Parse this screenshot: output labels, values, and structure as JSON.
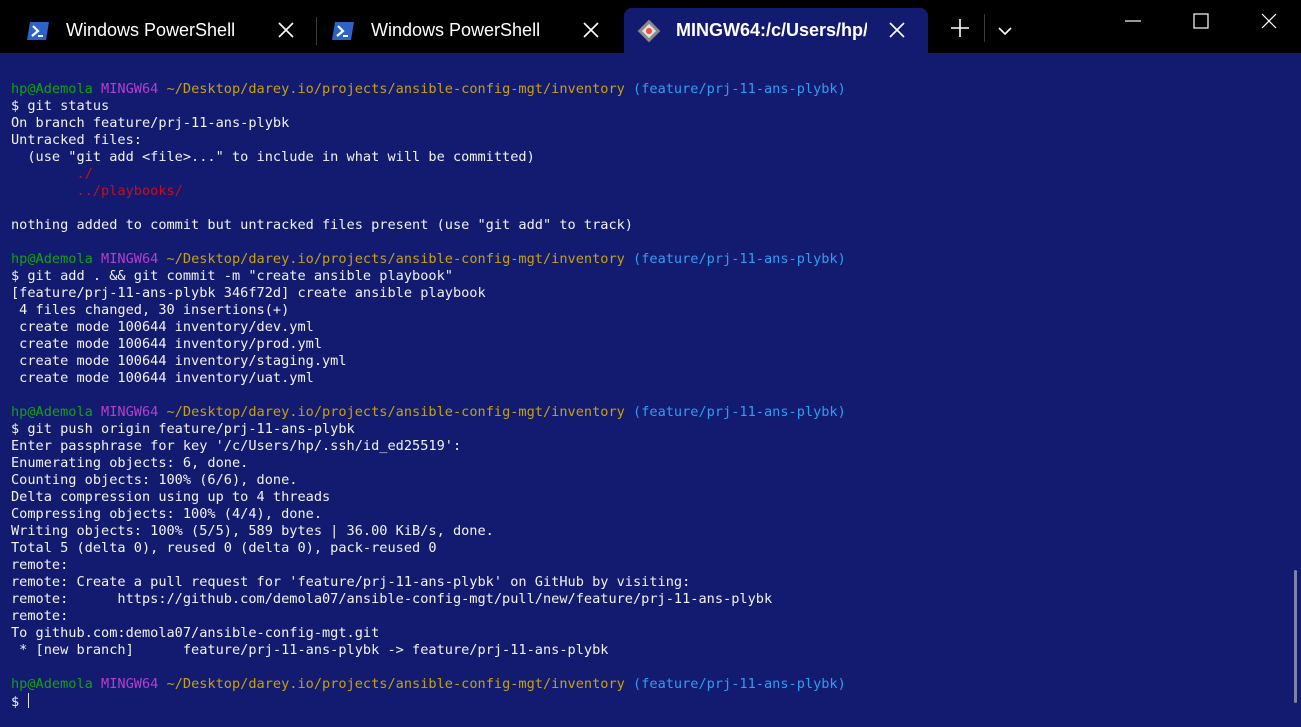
{
  "tabs": [
    {
      "label": "Windows PowerShell",
      "icon": "powershell-icon",
      "active": false
    },
    {
      "label": "Windows PowerShell",
      "icon": "powershell-icon",
      "active": false
    },
    {
      "label": "MINGW64:/c/Users/hp/",
      "icon": "git-bash-icon",
      "active": true
    }
  ],
  "prompt": {
    "user_host": "hp@Ademola",
    "shell": "MINGW64",
    "path": "~/Desktop/darey.io/projects/ansible-config-mgt/inventory",
    "branch": "(feature/prj-11-ans-plybk)"
  },
  "terminal": {
    "lines": [
      "$ git status",
      "On branch feature/prj-11-ans-plybk",
      "Untracked files:",
      "  (use \"git add <file>...\" to include in what will be committed)",
      "        ./",
      "        ../playbooks/",
      "nothing added to commit but untracked files present (use \"git add\" to track)",
      "$ git add . && git commit -m \"create ansible playbook\"",
      "[feature/prj-11-ans-plybk 346f72d] create ansible playbook",
      " 4 files changed, 30 insertions(+)",
      " create mode 100644 inventory/dev.yml",
      " create mode 100644 inventory/prod.yml",
      " create mode 100644 inventory/staging.yml",
      " create mode 100644 inventory/uat.yml",
      "$ git push origin feature/prj-11-ans-plybk",
      "Enter passphrase for key '/c/Users/hp/.ssh/id_ed25519':",
      "Enumerating objects: 6, done.",
      "Counting objects: 100% (6/6), done.",
      "Delta compression using up to 4 threads",
      "Compressing objects: 100% (4/4), done.",
      "Writing objects: 100% (5/5), 589 bytes | 36.00 KiB/s, done.",
      "Total 5 (delta 0), reused 0 (delta 0), pack-reused 0",
      "remote:",
      "remote: Create a pull request for 'feature/prj-11-ans-plybk' on GitHub by visiting:",
      "remote:      https://github.com/demola07/ansible-config-mgt/pull/new/feature/prj-11-ans-plybk",
      "remote:",
      "To github.com:demola07/ansible-config-mgt.git",
      " * [new branch]      feature/prj-11-ans-plybk -> feature/prj-11-ans-plybk",
      "$ "
    ]
  },
  "colors": {
    "background": "#131b70",
    "user_host": "#13a10e",
    "shell": "#b43fce",
    "path": "#c6a10d",
    "branch": "#2f9df2",
    "untracked": "#c50f1f"
  }
}
